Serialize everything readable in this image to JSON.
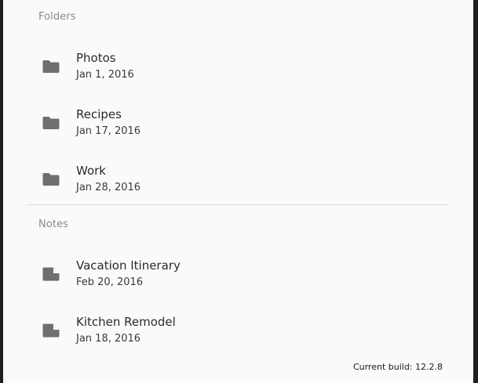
{
  "sections": {
    "folders_header": "Folders",
    "notes_header": "Notes"
  },
  "folders": [
    {
      "title": "Photos",
      "date": "Jan 1, 2016",
      "icon": "folder-icon"
    },
    {
      "title": "Recipes",
      "date": "Jan 17, 2016",
      "icon": "folder-icon"
    },
    {
      "title": "Work",
      "date": "Jan 28, 2016",
      "icon": "folder-icon"
    }
  ],
  "notes": [
    {
      "title": "Vacation Itinerary",
      "date": "Feb 20, 2016",
      "icon": "note-icon"
    },
    {
      "title": "Kitchen Remodel",
      "date": "Jan 18, 2016",
      "icon": "note-icon"
    }
  ],
  "footer": {
    "build": "Current build: 12.2.8"
  },
  "colors": {
    "icon": "#6f6f6f",
    "background": "#fafafa",
    "frame": "#1f1f1f"
  }
}
